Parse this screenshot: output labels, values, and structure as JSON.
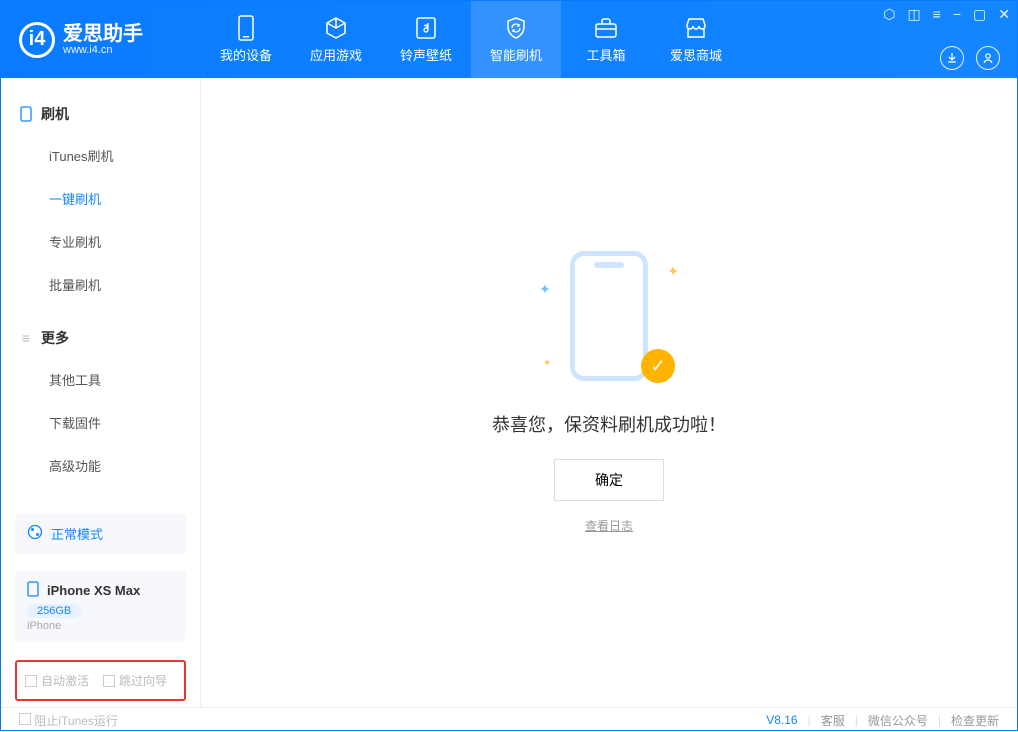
{
  "app": {
    "title": "爱思助手",
    "subtitle": "www.i4.cn"
  },
  "nav": {
    "items": [
      {
        "label": "我的设备",
        "icon": "phone"
      },
      {
        "label": "应用游戏",
        "icon": "cube"
      },
      {
        "label": "铃声壁纸",
        "icon": "music"
      },
      {
        "label": "智能刷机",
        "icon": "refresh",
        "active": true
      },
      {
        "label": "工具箱",
        "icon": "toolbox"
      },
      {
        "label": "爱思商城",
        "icon": "store"
      }
    ]
  },
  "sidebar": {
    "group1": {
      "title": "刷机",
      "items": [
        "iTunes刷机",
        "一键刷机",
        "专业刷机",
        "批量刷机"
      ],
      "active_index": 1
    },
    "group2": {
      "title": "更多",
      "items": [
        "其他工具",
        "下载固件",
        "高级功能"
      ]
    }
  },
  "device": {
    "mode_label": "正常模式",
    "name": "iPhone XS Max",
    "capacity": "256GB",
    "type": "iPhone"
  },
  "options": {
    "auto_activate": "自动激活",
    "skip_guide": "跳过向导"
  },
  "main": {
    "message": "恭喜您，保资料刷机成功啦！",
    "ok_label": "确定",
    "log_link": "查看日志"
  },
  "footer": {
    "block_itunes": "阻止iTunes运行",
    "version": "V8.16",
    "links": [
      "客服",
      "微信公众号",
      "检查更新"
    ]
  }
}
